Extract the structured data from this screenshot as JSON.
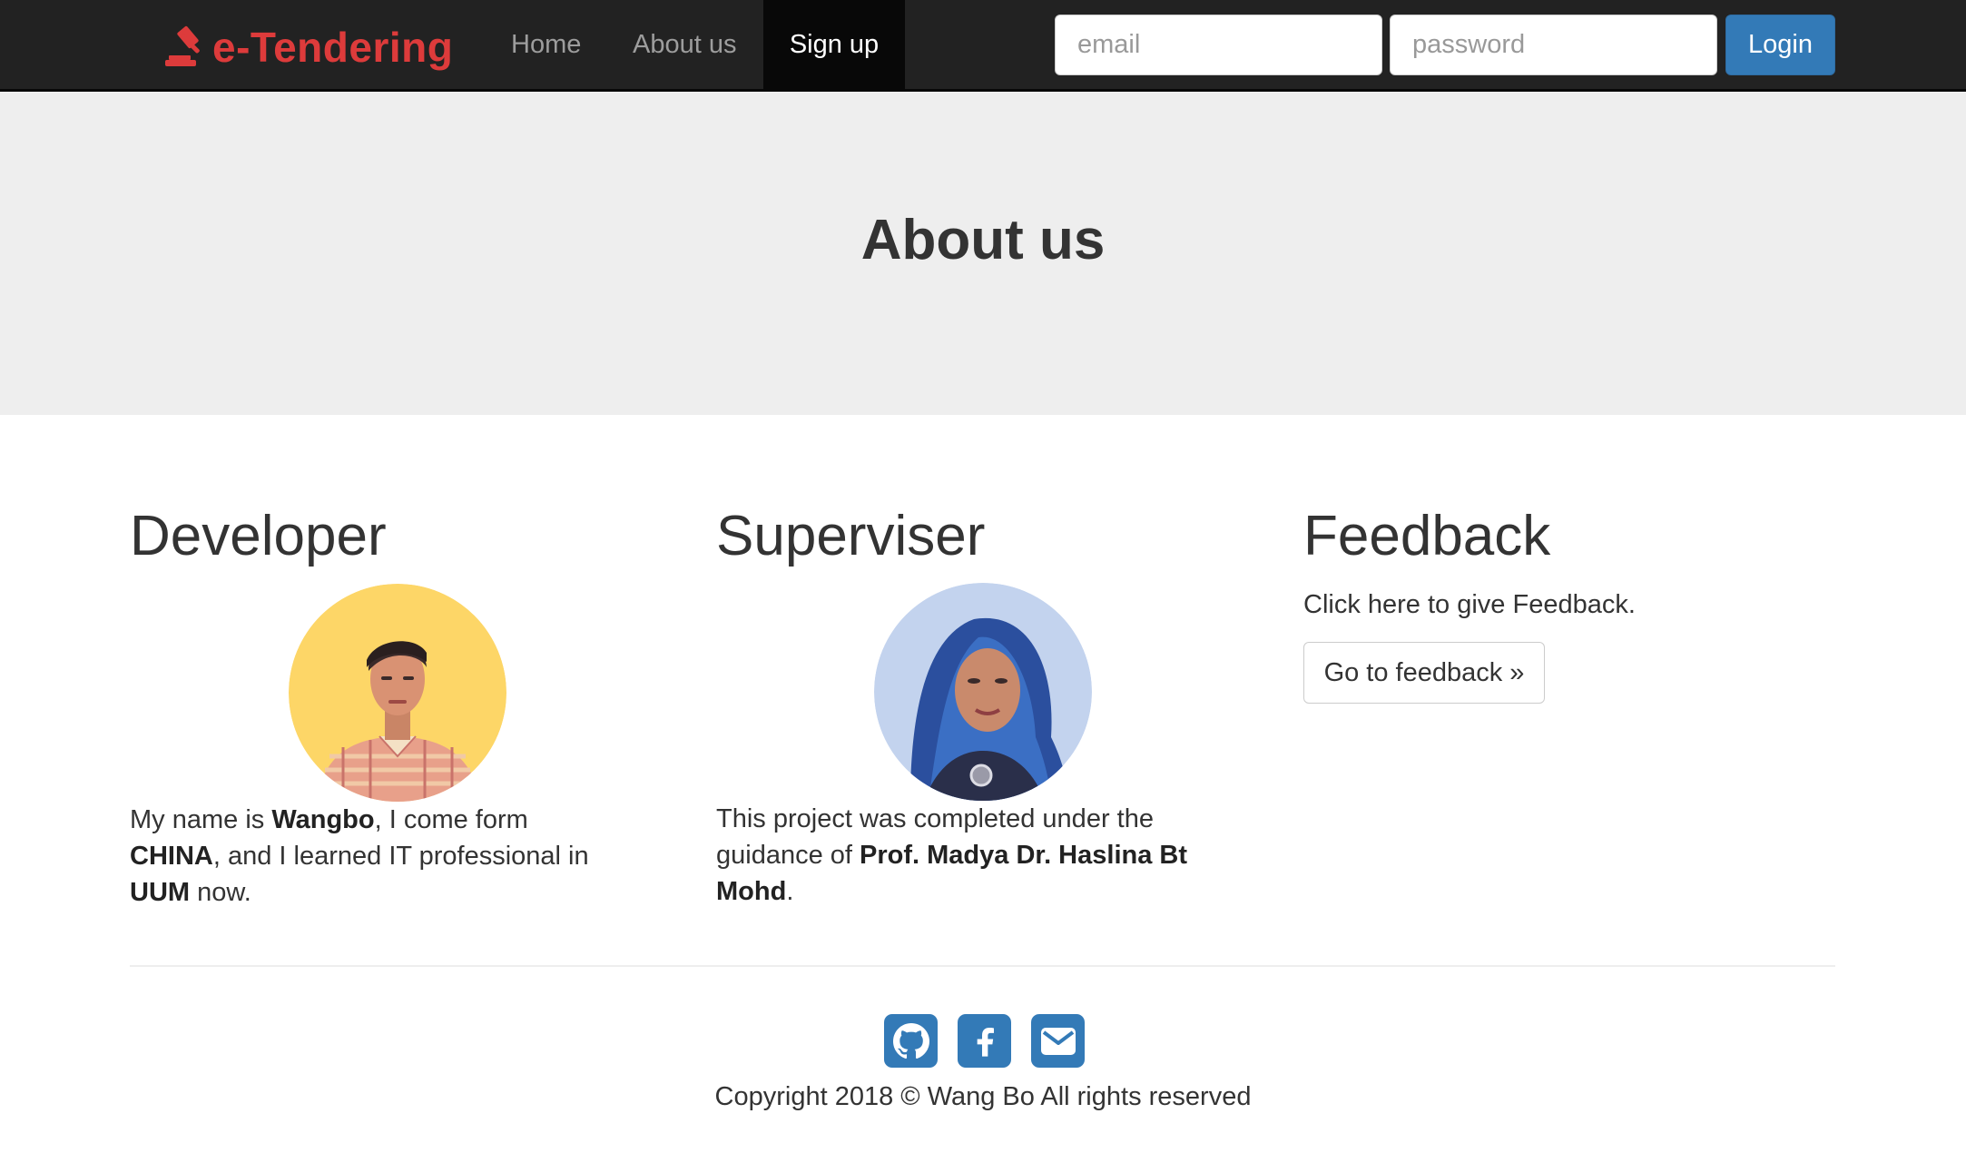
{
  "navbar": {
    "brand_icon": "gavel-icon",
    "brand_text": "e-Tendering",
    "brand_color": "#dd3b3b",
    "items": [
      {
        "label": "Home",
        "active": false
      },
      {
        "label": "About us",
        "active": false
      },
      {
        "label": "Sign up",
        "active": true
      }
    ],
    "login": {
      "email_placeholder": "email",
      "password_placeholder": "password",
      "button_label": "Login",
      "button_color": "#337ab7"
    }
  },
  "jumbotron": {
    "title": "About us"
  },
  "developer": {
    "heading": "Developer",
    "avatar": "developer-portrait",
    "text_1": "My name is ",
    "name": "Wangbo",
    "text_2": ", I come form ",
    "country": "CHINA",
    "text_3": ", and I learned IT professional in ",
    "university": "UUM",
    "text_4": " now."
  },
  "superviser": {
    "heading": "Superviser",
    "avatar": "superviser-portrait",
    "text_1": "This project was completed under the guidance of ",
    "name": "Prof. Madya Dr. Haslina Bt Mohd",
    "text_2": "."
  },
  "feedback": {
    "heading": "Feedback",
    "text": "Click here to give Feedback.",
    "button_label": "Go to feedback »"
  },
  "footer": {
    "social_icons": [
      "github-icon",
      "facebook-icon",
      "envelope-icon"
    ],
    "icon_color": "#337ab7",
    "copyright": "Copyright 2018 © Wang Bo All rights reserved"
  }
}
